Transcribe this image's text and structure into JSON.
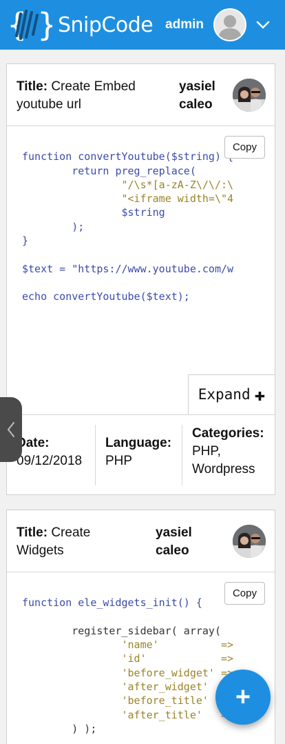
{
  "header": {
    "brand": "SnipCode",
    "username": "admin"
  },
  "icons": {
    "logo": "snipcode-logo-icon",
    "avatar": "user-avatar-icon",
    "dropdown": "chevron-down-icon",
    "sidebar_toggle": "chevron-left-icon",
    "add": "plus-icon"
  },
  "colors": {
    "primary": "#1e8fe0",
    "code_keyword": "#3b4ba8",
    "code_string": "#9b8328"
  },
  "snippets": [
    {
      "title_label": "Title:",
      "title": "Create Embed youtube url",
      "author": "yasiel caleo",
      "copy_label": "Copy",
      "expand_label": "Expand",
      "code_lines": [
        "",
        "function convertYoutube($string) {",
        "        return preg_replace(",
        "                \"/\\s*[a-zA-Z\\/\\/:\\",
        "                \"<iframe width=\\\"4",
        "                $string",
        "        );",
        "}",
        "",
        "$text = \"https://www.youtube.com/w",
        "",
        "echo convertYoutube($text);"
      ],
      "date_label": "Date:",
      "date": "09/12/2018",
      "language_label": "Language:",
      "language": "PHP",
      "categories_label": "Categories:",
      "categories": "PHP, Wordpress"
    },
    {
      "title_label": "Title:",
      "title": "Create Widgets",
      "author": "yasiel caleo",
      "copy_label": "Copy",
      "code_lines": [
        "",
        "function ele_widgets_init() {",
        "",
        "        register_sidebar( array(",
        "                'name'          =>",
        "                'id'            =>",
        "                'before_widget' =>",
        "                'after_widget'  =>",
        "                'before_title'  =>",
        "                'after_title'   =>",
        "        ) );"
      ]
    }
  ],
  "fab_label": "+"
}
